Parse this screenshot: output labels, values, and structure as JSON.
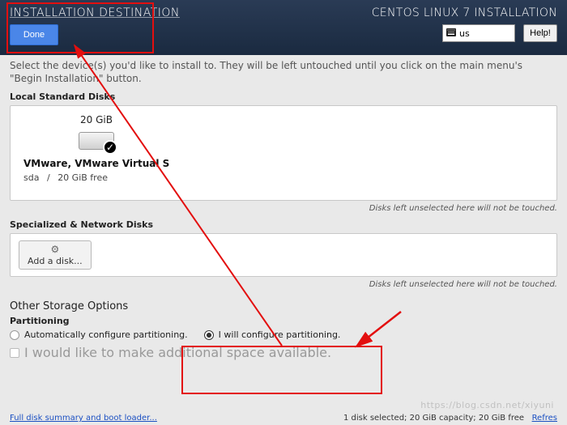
{
  "header": {
    "title": "INSTALLATION DESTINATION",
    "done_label": "Done",
    "subtitle": "CENTOS LINUX 7 INSTALLATION",
    "keyboard": "us",
    "help_label": "Help!"
  },
  "intro": "Select the device(s) you'd like to install to. They will be left untouched until you click on the main menu's \"Begin Installation\" button.",
  "local_disks": {
    "section": "Local Standard Disks",
    "disk": {
      "size": "20 GiB",
      "name": "VMware, VMware Virtual S",
      "device": "sda",
      "free": "20 GiB free",
      "selected": true
    },
    "note": "Disks left unselected here will not be touched."
  },
  "special_disks": {
    "section": "Specialized & Network Disks",
    "add_label": "Add a disk...",
    "note": "Disks left unselected here will not be touched."
  },
  "other": {
    "title": "Other Storage Options",
    "partitioning_label": "Partitioning",
    "auto": "Automatically configure partitioning.",
    "manual": "I will configure partitioning.",
    "additional": "I would like to make additional space available.",
    "selected": "manual"
  },
  "footer": {
    "summary_link": "Full disk summary and boot loader...",
    "status": "1 disk selected; 20 GiB capacity; 20 GiB free",
    "refresh": "Refres"
  },
  "watermark": "https://blog.csdn.net/xiyuni",
  "colors": {
    "accent": "#4a86e8",
    "danger": "#e30f0f",
    "link": "#1a4fc2"
  }
}
